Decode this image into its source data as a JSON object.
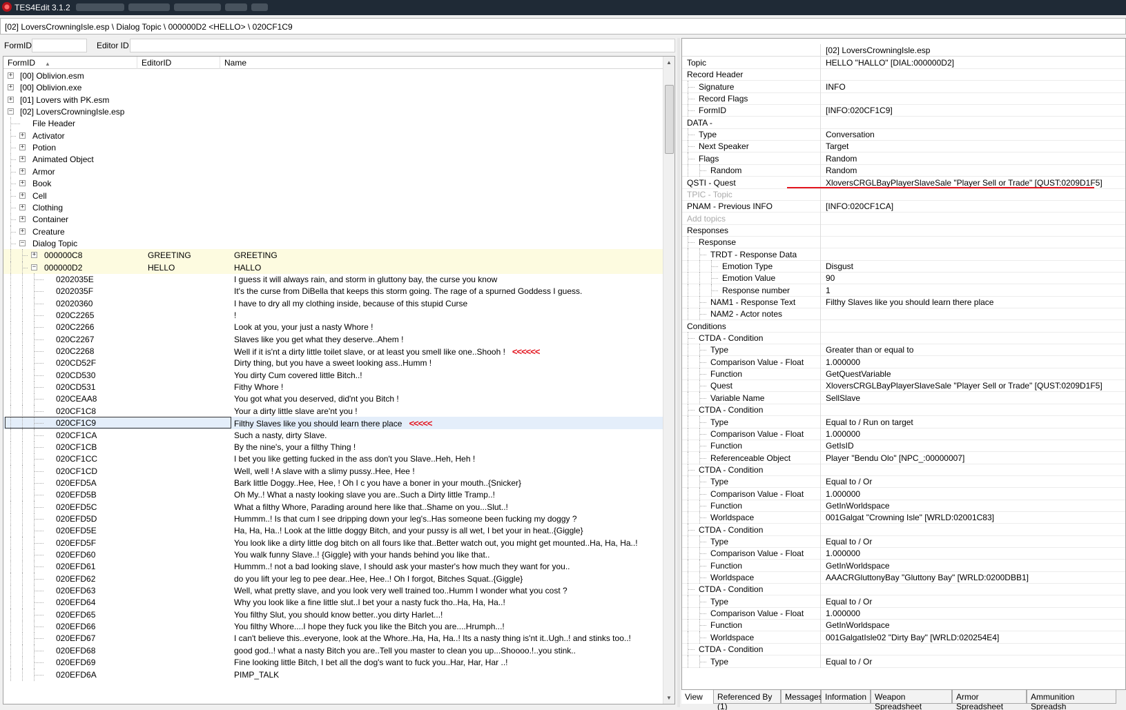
{
  "window": {
    "title": "TES4Edit 3.1.2"
  },
  "path": "[02] LoversCrowningIsle.esp \\ Dialog Topic \\ 000000D2 <HELLO> \\ 020CF1C9",
  "filter": {
    "formid_label": "FormID",
    "editorid_label": "Editor ID"
  },
  "tree": {
    "columns": {
      "formid": "FormID",
      "editorid": "EditorID",
      "name": "Name"
    },
    "rows": [
      {
        "id": "[00] Oblivion.esm",
        "editor": "",
        "name": "",
        "level": 0,
        "exp": "+"
      },
      {
        "id": "[00] Oblivion.exe",
        "editor": "",
        "name": "",
        "level": 0,
        "exp": "+"
      },
      {
        "id": "[01] Lovers with PK.esm",
        "editor": "",
        "name": "",
        "level": 0,
        "exp": "+"
      },
      {
        "id": "[02] LoversCrowningIsle.esp",
        "editor": "",
        "name": "",
        "level": 0,
        "exp": "-"
      },
      {
        "id": "File Header",
        "editor": "",
        "name": "",
        "level": 1,
        "exp": ""
      },
      {
        "id": "Activator",
        "editor": "",
        "name": "",
        "level": 1,
        "exp": "+"
      },
      {
        "id": "Potion",
        "editor": "",
        "name": "",
        "level": 1,
        "exp": "+"
      },
      {
        "id": "Animated Object",
        "editor": "",
        "name": "",
        "level": 1,
        "exp": "+"
      },
      {
        "id": "Armor",
        "editor": "",
        "name": "",
        "level": 1,
        "exp": "+"
      },
      {
        "id": "Book",
        "editor": "",
        "name": "",
        "level": 1,
        "exp": "+"
      },
      {
        "id": "Cell",
        "editor": "",
        "name": "",
        "level": 1,
        "exp": "+"
      },
      {
        "id": "Clothing",
        "editor": "",
        "name": "",
        "level": 1,
        "exp": "+"
      },
      {
        "id": "Container",
        "editor": "",
        "name": "",
        "level": 1,
        "exp": "+"
      },
      {
        "id": "Creature",
        "editor": "",
        "name": "",
        "level": 1,
        "exp": "+"
      },
      {
        "id": "Dialog Topic",
        "editor": "",
        "name": "",
        "level": 1,
        "exp": "-"
      },
      {
        "id": "000000C8",
        "editor": "GREETING",
        "name": "GREETING",
        "level": 2,
        "exp": "+",
        "hl": true
      },
      {
        "id": "000000D2",
        "editor": "HELLO",
        "name": "HALLO",
        "level": 2,
        "exp": "-",
        "hl": true
      },
      {
        "id": "0202035E",
        "editor": "",
        "name": "I guess it will always rain, and storm in gluttony bay, the curse you know",
        "level": 3,
        "exp": ""
      },
      {
        "id": "0202035F",
        "editor": "",
        "name": "It's the curse from DiBella that keeps this storm going. The rage of a spurned Goddess I guess.",
        "level": 3,
        "exp": ""
      },
      {
        "id": "02020360",
        "editor": "",
        "name": "I have to dry all my clothing inside, because of this stupid Curse",
        "level": 3,
        "exp": ""
      },
      {
        "id": "020C2265",
        "editor": "",
        "name": " !",
        "level": 3,
        "exp": ""
      },
      {
        "id": "020C2266",
        "editor": "",
        "name": "Look at you, your just a nasty Whore !",
        "level": 3,
        "exp": ""
      },
      {
        "id": "020C2267",
        "editor": "",
        "name": "Slaves like you get what they deserve..Ahem !",
        "level": 3,
        "exp": ""
      },
      {
        "id": "020C2268",
        "editor": "",
        "name": "Well if it is'nt a dirty little toilet slave, or at least you smell like one..Shooh !",
        "level": 3,
        "exp": "",
        "arrow": "<<<<<<"
      },
      {
        "id": "020CD52F",
        "editor": "",
        "name": "Dirty thing, but you have a sweet looking ass..Humm !",
        "level": 3,
        "exp": ""
      },
      {
        "id": "020CD530",
        "editor": "",
        "name": "You dirty Cum covered little Bitch..!",
        "level": 3,
        "exp": ""
      },
      {
        "id": "020CD531",
        "editor": "",
        "name": "Fithy Whore !",
        "level": 3,
        "exp": ""
      },
      {
        "id": "020CEAA8",
        "editor": "",
        "name": "You got what you deserved, did'nt you Bitch !",
        "level": 3,
        "exp": ""
      },
      {
        "id": "020CF1C8",
        "editor": "",
        "name": "Your a dirty little slave are'nt you !",
        "level": 3,
        "exp": ""
      },
      {
        "id": "020CF1C9",
        "editor": "",
        "name": "Filthy Slaves like you should learn there place",
        "level": 3,
        "exp": "",
        "sel": true,
        "arrow": "<<<<<"
      },
      {
        "id": "020CF1CA",
        "editor": "",
        "name": "Such a nasty, dirty Slave.",
        "level": 3,
        "exp": ""
      },
      {
        "id": "020CF1CB",
        "editor": "",
        "name": "By the nine's, your a filthy Thing !",
        "level": 3,
        "exp": ""
      },
      {
        "id": "020CF1CC",
        "editor": "",
        "name": "I bet you like getting fucked in the ass don't you Slave..Heh, Heh !",
        "level": 3,
        "exp": ""
      },
      {
        "id": "020CF1CD",
        "editor": "",
        "name": "Well, well ! A slave with a slimy pussy..Hee, Hee !",
        "level": 3,
        "exp": ""
      },
      {
        "id": "020EFD5A",
        "editor": "",
        "name": "Bark little Doggy..Hee, Hee, ! Oh I c you have a boner in your mouth..{Snicker}",
        "level": 3,
        "exp": ""
      },
      {
        "id": "020EFD5B",
        "editor": "",
        "name": "Oh My..!  What a nasty looking slave you are..Such a Dirty little Tramp..!",
        "level": 3,
        "exp": ""
      },
      {
        "id": "020EFD5C",
        "editor": "",
        "name": "What a filthy Whore, Parading around here like that..Shame on you...Slut..!",
        "level": 3,
        "exp": ""
      },
      {
        "id": "020EFD5D",
        "editor": "",
        "name": "Hummm..! Is that cum I see dripping down your leg's..Has someone been fucking my doggy ?",
        "level": 3,
        "exp": ""
      },
      {
        "id": "020EFD5E",
        "editor": "",
        "name": "Ha, Ha, Ha..! Look at the little doggy Bitch, and your pussy is all wet, I bet your in heat..{Giggle}",
        "level": 3,
        "exp": ""
      },
      {
        "id": "020EFD5F",
        "editor": "",
        "name": "You look like a dirty little dog bitch on all fours like that..Better watch out, you might get mounted..Ha, Ha, Ha..!",
        "level": 3,
        "exp": ""
      },
      {
        "id": "020EFD60",
        "editor": "",
        "name": "You walk funny Slave..! {Giggle} with your hands behind you like that..",
        "level": 3,
        "exp": ""
      },
      {
        "id": "020EFD61",
        "editor": "",
        "name": "Hummm..! not a bad looking slave, I should ask your master's how much they want for you..",
        "level": 3,
        "exp": ""
      },
      {
        "id": "020EFD62",
        "editor": "",
        "name": "do you lift your leg to pee dear..Hee, Hee..! Oh I forgot, Bitches Squat..{Giggle}",
        "level": 3,
        "exp": ""
      },
      {
        "id": "020EFD63",
        "editor": "",
        "name": "Well, what pretty slave, and you look very well trained too..Humm I wonder what you cost ?",
        "level": 3,
        "exp": ""
      },
      {
        "id": "020EFD64",
        "editor": "",
        "name": "Why you look like a fine little slut..I bet your a nasty fuck tho..Ha, Ha, Ha..!",
        "level": 3,
        "exp": ""
      },
      {
        "id": "020EFD65",
        "editor": "",
        "name": "You filthy Slut, you should know better..you dirty Harlet...!",
        "level": 3,
        "exp": ""
      },
      {
        "id": "020EFD66",
        "editor": "",
        "name": "You filthy Whore....I hope they fuck you like the Bitch you are....Hrumph...!",
        "level": 3,
        "exp": ""
      },
      {
        "id": "020EFD67",
        "editor": "",
        "name": "I can't believe this..everyone, look at the Whore..Ha, Ha, Ha..! Its a nasty thing is'nt it..Ugh..! and stinks too..!",
        "level": 3,
        "exp": ""
      },
      {
        "id": "020EFD68",
        "editor": "",
        "name": "good god..! what a nasty Bitch you are..Tell you master to clean you up...Shoooo.!..you stink..",
        "level": 3,
        "exp": ""
      },
      {
        "id": "020EFD69",
        "editor": "",
        "name": "Fine looking little Bitch, I bet all the dog's want to fuck you..Har, Har, Har ..!",
        "level": 3,
        "exp": ""
      },
      {
        "id": "020EFD6A",
        "editor": "",
        "name": "PIMP_TALK",
        "level": 3,
        "exp": ""
      }
    ]
  },
  "details": {
    "header": "[02] LoversCrowningIsle.esp",
    "rows": [
      {
        "name": "Topic",
        "value": "HELLO \"HALLO\" [DIAL:000000D2]",
        "level": 0
      },
      {
        "name": "Record Header",
        "value": "",
        "level": 0
      },
      {
        "name": "Signature",
        "value": "INFO",
        "level": 1
      },
      {
        "name": "Record Flags",
        "value": "",
        "level": 1
      },
      {
        "name": "FormID",
        "value": "[INFO:020CF1C9]",
        "level": 1
      },
      {
        "name": "DATA -",
        "value": "",
        "level": 0
      },
      {
        "name": "Type",
        "value": "Conversation",
        "level": 1
      },
      {
        "name": "Next Speaker",
        "value": "Target",
        "level": 1
      },
      {
        "name": "Flags",
        "value": "Random",
        "level": 1
      },
      {
        "name": "Random",
        "value": "Random",
        "level": 2
      },
      {
        "name": "QSTI - Quest",
        "value": "XloversCRGLBayPlayerSlaveSale \"Player Sell or Trade\" [QUST:0209D1F5]",
        "level": 0
      },
      {
        "name": "TPIC - Topic",
        "value": "",
        "level": 0,
        "grey": true
      },
      {
        "name": "PNAM - Previous INFO",
        "value": "[INFO:020CF1CA]",
        "level": 0
      },
      {
        "name": "Add topics",
        "value": "",
        "level": 0,
        "grey": true
      },
      {
        "name": "Responses",
        "value": "",
        "level": 0
      },
      {
        "name": "Response",
        "value": "",
        "level": 1
      },
      {
        "name": "TRDT - Response Data",
        "value": "",
        "level": 2
      },
      {
        "name": "Emotion Type",
        "value": "Disgust",
        "level": 3
      },
      {
        "name": "Emotion Value",
        "value": "90",
        "level": 3
      },
      {
        "name": "Response number",
        "value": "1",
        "level": 3
      },
      {
        "name": "NAM1 - Response Text",
        "value": "Filthy Slaves like you should learn there place",
        "level": 2
      },
      {
        "name": "NAM2 - Actor notes",
        "value": "",
        "level": 2
      },
      {
        "name": "Conditions",
        "value": "",
        "level": 0
      },
      {
        "name": "CTDA - Condition",
        "value": "",
        "level": 1
      },
      {
        "name": "Type",
        "value": "Greater than or equal to",
        "level": 2
      },
      {
        "name": "Comparison Value - Float",
        "value": "1.000000",
        "level": 2
      },
      {
        "name": "Function",
        "value": "GetQuestVariable",
        "level": 2
      },
      {
        "name": "Quest",
        "value": "XloversCRGLBayPlayerSlaveSale \"Player Sell or Trade\" [QUST:0209D1F5]",
        "level": 2
      },
      {
        "name": "Variable Name",
        "value": "SellSlave",
        "level": 2
      },
      {
        "name": "CTDA - Condition",
        "value": "",
        "level": 1
      },
      {
        "name": "Type",
        "value": "Equal to / Run on target",
        "level": 2
      },
      {
        "name": "Comparison Value - Float",
        "value": "1.000000",
        "level": 2
      },
      {
        "name": "Function",
        "value": "GetIsID",
        "level": 2
      },
      {
        "name": "Referenceable Object",
        "value": "Player \"Bendu Olo\" [NPC_:00000007]",
        "level": 2
      },
      {
        "name": "CTDA - Condition",
        "value": "",
        "level": 1
      },
      {
        "name": "Type",
        "value": "Equal to / Or",
        "level": 2
      },
      {
        "name": "Comparison Value - Float",
        "value": "1.000000",
        "level": 2
      },
      {
        "name": "Function",
        "value": "GetInWorldspace",
        "level": 2
      },
      {
        "name": "Worldspace",
        "value": "001Galgat \"Crowning Isle\" [WRLD:02001C83]",
        "level": 2
      },
      {
        "name": "CTDA - Condition",
        "value": "",
        "level": 1
      },
      {
        "name": "Type",
        "value": "Equal to / Or",
        "level": 2
      },
      {
        "name": "Comparison Value - Float",
        "value": "1.000000",
        "level": 2
      },
      {
        "name": "Function",
        "value": "GetInWorldspace",
        "level": 2
      },
      {
        "name": "Worldspace",
        "value": "AAACRGluttonyBay \"Gluttony Bay\" [WRLD:0200DBB1]",
        "level": 2
      },
      {
        "name": "CTDA - Condition",
        "value": "",
        "level": 1
      },
      {
        "name": "Type",
        "value": "Equal to / Or",
        "level": 2
      },
      {
        "name": "Comparison Value - Float",
        "value": "1.000000",
        "level": 2
      },
      {
        "name": "Function",
        "value": "GetInWorldspace",
        "level": 2
      },
      {
        "name": "Worldspace",
        "value": "001GalgatIsle02 \"Dirty Bay\" [WRLD:020254E4]",
        "level": 2
      },
      {
        "name": "CTDA - Condition",
        "value": "",
        "level": 1
      },
      {
        "name": "Type",
        "value": "Equal to / Or",
        "level": 2
      }
    ]
  },
  "tabs": [
    "View",
    "Referenced By (1)",
    "Messages",
    "Information",
    "Weapon Spreadsheet",
    "Armor Spreadsheet",
    "Ammunition Spreadsh"
  ],
  "colors": {
    "highlight_row": "#fdfbe0",
    "selected_row": "#e4eefa",
    "annotation_red": "#e3141e"
  }
}
